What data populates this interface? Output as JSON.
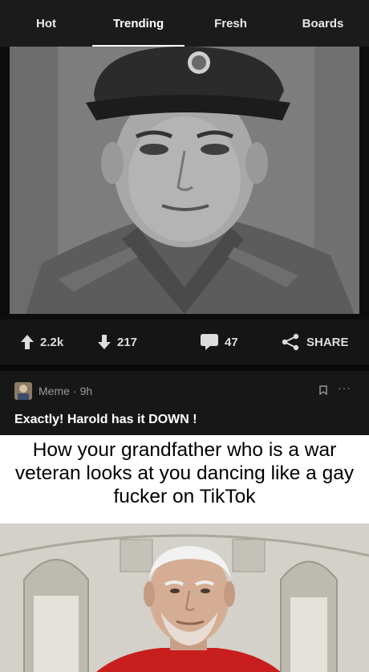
{
  "tabs": [
    {
      "label": "Hot",
      "active": false
    },
    {
      "label": "Trending",
      "active": true
    },
    {
      "label": "Fresh",
      "active": false
    },
    {
      "label": "Boards",
      "active": false
    }
  ],
  "post1": {
    "upvotes": "2.2k",
    "downvotes": "217",
    "comments": "47",
    "share_label": "SHARE"
  },
  "post2": {
    "section": "Meme",
    "separator": "·",
    "age": "9h",
    "more": "···",
    "title": "Exactly! Harold has it DOWN !",
    "caption": "How your grandfather who is a war veteran looks at you dancing like a gay fucker on TikTok"
  },
  "colors": {
    "background": "#000000",
    "tabbar": "#1b1b1b",
    "action_bar": "#151515",
    "post_header": "#171717"
  }
}
